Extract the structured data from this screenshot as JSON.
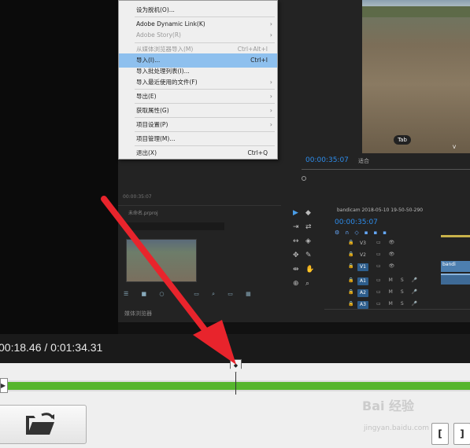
{
  "file_menu": {
    "items": [
      {
        "label": "设为脱机(O)...",
        "shortcut": "",
        "submenu": false,
        "disabled": false
      },
      {
        "label": "Adobe Dynamic Link(K)",
        "shortcut": "",
        "submenu": true,
        "disabled": false
      },
      {
        "label": "Adobe Story(R)",
        "shortcut": "",
        "submenu": true,
        "disabled": true
      },
      {
        "label": "从媒体浏览器导入(M)",
        "shortcut": "Ctrl+Alt+I",
        "submenu": false,
        "disabled": true
      },
      {
        "label": "导入(I)...",
        "shortcut": "Ctrl+I",
        "submenu": false,
        "disabled": false,
        "highlighted": true
      },
      {
        "label": "导入批处理列表(I)...",
        "shortcut": "",
        "submenu": false,
        "disabled": false
      },
      {
        "label": "导入最近使用的文件(F)",
        "shortcut": "",
        "submenu": true,
        "disabled": false
      },
      {
        "label": "导出(E)",
        "shortcut": "",
        "submenu": true,
        "disabled": false
      },
      {
        "label": "获取属性(G)",
        "shortcut": "",
        "submenu": true,
        "disabled": false
      },
      {
        "label": "项目设置(P)",
        "shortcut": "",
        "submenu": true,
        "disabled": false
      },
      {
        "label": "项目管理(M)...",
        "shortcut": "",
        "submenu": false,
        "disabled": false
      },
      {
        "label": "退出(X)",
        "shortcut": "Ctrl+Q",
        "submenu": false,
        "disabled": false
      }
    ]
  },
  "program_monitor": {
    "timecode": "00:00:35:07",
    "zoom": "适合",
    "tab_key": "Tab",
    "v_key": "V"
  },
  "source_timecode": "00:00:35:07",
  "project_panel": {
    "title": "未命名.prproj",
    "media_browser_tab": "媒体浏览器"
  },
  "timeline": {
    "title": "bandicam 2018-05-10 19-50-50-290",
    "timecode": "00:00:35:07",
    "clip_label": "bandi",
    "tracks": [
      "V3",
      "V2",
      "V1",
      "A1",
      "A2",
      "A3"
    ],
    "active_tracks": [
      "V1",
      "A1",
      "A2",
      "A3"
    ]
  },
  "player": {
    "time_readout": "00:18.46 / 0:01:34.31",
    "progress_fraction": 0.5
  },
  "watermark": {
    "brand": "Bai 经验",
    "url": "jingyan.baidu.com"
  },
  "colors": {
    "highlight": "#8ec0ee",
    "timecode": "#2d8ceb",
    "progress": "#55b52c",
    "arrow": "#e8242c"
  },
  "icons": [
    "folder-open-icon",
    "play-icon",
    "bracket-left-icon",
    "bracket-right-icon"
  ]
}
